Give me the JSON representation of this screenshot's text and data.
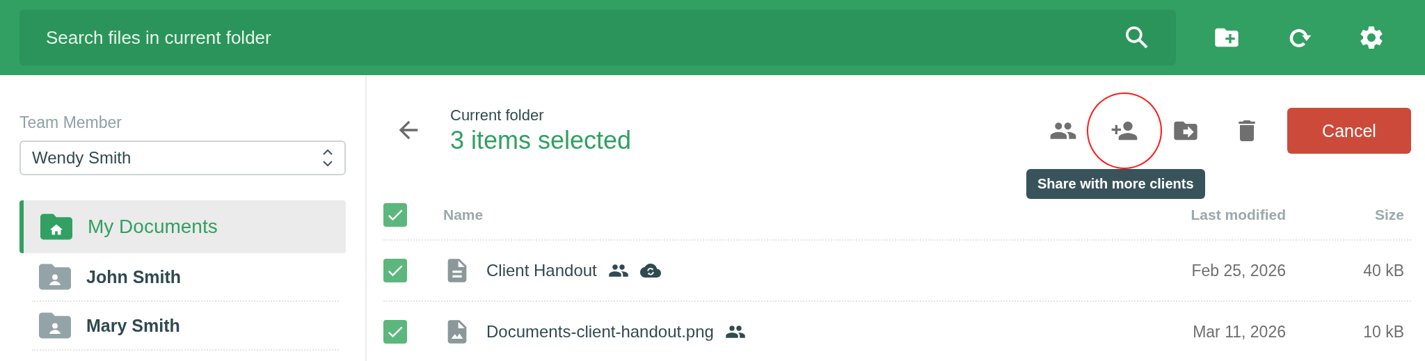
{
  "search": {
    "placeholder": "Search files in current folder"
  },
  "sidebar": {
    "label": "Team Member",
    "member_select": {
      "value": "Wendy Smith"
    },
    "items": [
      {
        "label": "My Documents",
        "kind": "home",
        "selected": true
      },
      {
        "label": "John Smith",
        "kind": "member",
        "selected": false
      },
      {
        "label": "Mary Smith",
        "kind": "member",
        "selected": false
      }
    ]
  },
  "header": {
    "caption": "Current folder",
    "selection": "3 items selected"
  },
  "actions": [
    {
      "kind": "share",
      "highlighted": false
    },
    {
      "kind": "add-client",
      "highlighted": true
    },
    {
      "kind": "move",
      "highlighted": false
    },
    {
      "kind": "delete",
      "highlighted": false
    }
  ],
  "tooltip": "Share with more clients",
  "cancel": "Cancel",
  "table": {
    "all_checked": true,
    "columns": [
      "Name",
      "Last modified",
      "Size"
    ],
    "rows": [
      {
        "checked": true,
        "kind": "document",
        "name": "Client Handout",
        "shared": true,
        "synced": true,
        "modified": "Feb 25, 2026",
        "size": "40 kB"
      },
      {
        "checked": true,
        "kind": "image",
        "name": "Documents-client-handout.png",
        "shared": true,
        "synced": false,
        "modified": "Mar 11, 2026",
        "size": "10 kB"
      }
    ]
  }
}
